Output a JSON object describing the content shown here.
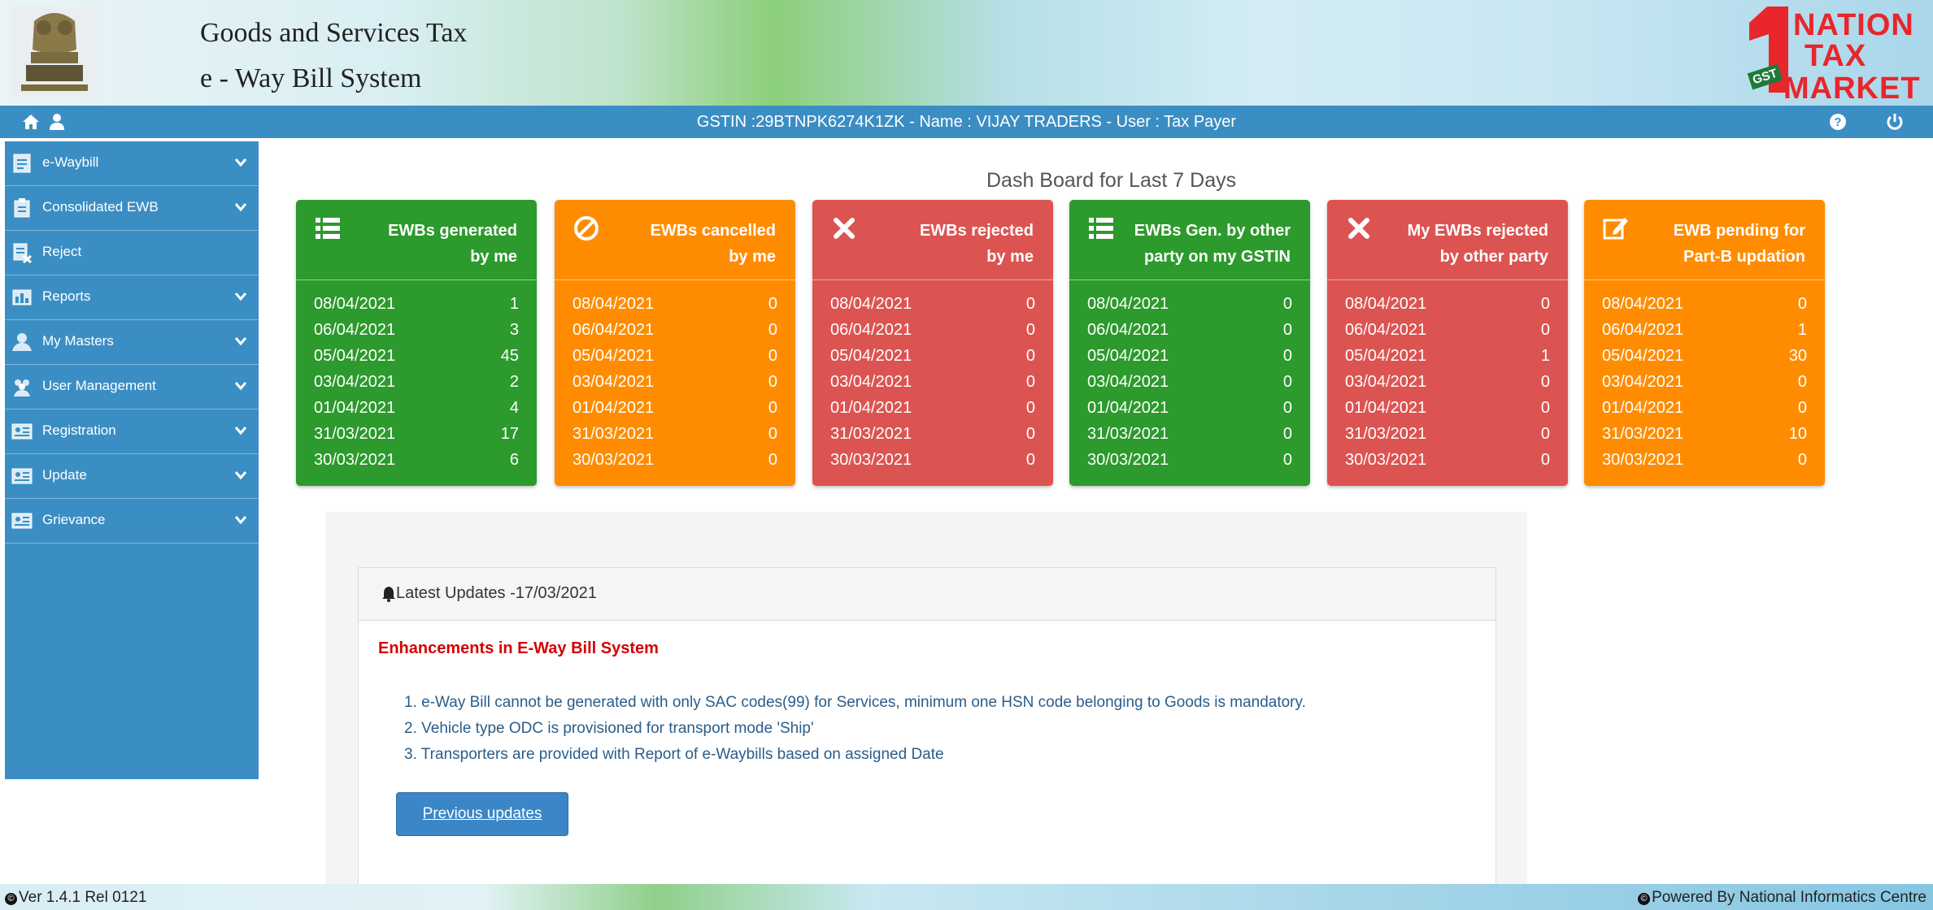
{
  "header": {
    "title": "Goods and Services Tax",
    "subtitle": "e - Way Bill System",
    "logo": {
      "line1": "NATION",
      "line2": "TAX",
      "line3": "MARKET",
      "badge": "GST"
    }
  },
  "topbar": {
    "gstin_text": "GSTIN :29BTNPK6274K1ZK - Name : VIJAY TRADERS - User : Tax Payer",
    "icons": [
      "home-icon",
      "user-icon",
      "help-icon",
      "power-icon"
    ]
  },
  "sidebar": {
    "items": [
      {
        "label": "e-Waybill",
        "icon": "document-icon",
        "has_submenu": true
      },
      {
        "label": "Consolidated EWB",
        "icon": "clipboard-icon",
        "has_submenu": true
      },
      {
        "label": "Reject",
        "icon": "reject-document-icon",
        "has_submenu": false
      },
      {
        "label": "Reports",
        "icon": "report-icon",
        "has_submenu": true
      },
      {
        "label": "My Masters",
        "icon": "user-master-icon",
        "has_submenu": true
      },
      {
        "label": "User Management",
        "icon": "users-icon",
        "has_submenu": true
      },
      {
        "label": "Registration",
        "icon": "id-card-icon",
        "has_submenu": true
      },
      {
        "label": "Update",
        "icon": "id-card-icon",
        "has_submenu": true
      },
      {
        "label": "Grievance",
        "icon": "id-card-icon",
        "has_submenu": true
      }
    ]
  },
  "dashboard": {
    "title": "Dash Board for Last 7 Days",
    "cards": [
      {
        "title_line1": "EWBs generated",
        "title_line2": "by me",
        "color": "#2c9a2c",
        "icon": "list-icon",
        "rows": [
          [
            "08/04/2021",
            "1"
          ],
          [
            "06/04/2021",
            "3"
          ],
          [
            "05/04/2021",
            "45"
          ],
          [
            "03/04/2021",
            "2"
          ],
          [
            "01/04/2021",
            "4"
          ],
          [
            "31/03/2021",
            "17"
          ],
          [
            "30/03/2021",
            "6"
          ]
        ]
      },
      {
        "title_line1": "EWBs cancelled",
        "title_line2": "by me",
        "color": "#ff8c00",
        "icon": "ban-icon",
        "rows": [
          [
            "08/04/2021",
            "0"
          ],
          [
            "06/04/2021",
            "0"
          ],
          [
            "05/04/2021",
            "0"
          ],
          [
            "03/04/2021",
            "0"
          ],
          [
            "01/04/2021",
            "0"
          ],
          [
            "31/03/2021",
            "0"
          ],
          [
            "30/03/2021",
            "0"
          ]
        ]
      },
      {
        "title_line1": "EWBs rejected",
        "title_line2": "by me",
        "color": "#dc5451",
        "icon": "close-icon",
        "rows": [
          [
            "08/04/2021",
            "0"
          ],
          [
            "06/04/2021",
            "0"
          ],
          [
            "05/04/2021",
            "0"
          ],
          [
            "03/04/2021",
            "0"
          ],
          [
            "01/04/2021",
            "0"
          ],
          [
            "31/03/2021",
            "0"
          ],
          [
            "30/03/2021",
            "0"
          ]
        ]
      },
      {
        "title_line1": "EWBs Gen. by other",
        "title_line2": "party on my GSTIN",
        "color": "#2c9a2c",
        "icon": "list-icon",
        "rows": [
          [
            "08/04/2021",
            "0"
          ],
          [
            "06/04/2021",
            "0"
          ],
          [
            "05/04/2021",
            "0"
          ],
          [
            "03/04/2021",
            "0"
          ],
          [
            "01/04/2021",
            "0"
          ],
          [
            "31/03/2021",
            "0"
          ],
          [
            "30/03/2021",
            "0"
          ]
        ]
      },
      {
        "title_line1": "My EWBs rejected",
        "title_line2": "by other party",
        "color": "#dc5451",
        "icon": "close-icon",
        "rows": [
          [
            "08/04/2021",
            "0"
          ],
          [
            "06/04/2021",
            "0"
          ],
          [
            "05/04/2021",
            "1"
          ],
          [
            "03/04/2021",
            "0"
          ],
          [
            "01/04/2021",
            "0"
          ],
          [
            "31/03/2021",
            "0"
          ],
          [
            "30/03/2021",
            "0"
          ]
        ]
      },
      {
        "title_line1": "EWB pending for",
        "title_line2": "Part-B updation",
        "color": "#ff8c00",
        "icon": "edit-icon",
        "rows": [
          [
            "08/04/2021",
            "0"
          ],
          [
            "06/04/2021",
            "1"
          ],
          [
            "05/04/2021",
            "30"
          ],
          [
            "03/04/2021",
            "0"
          ],
          [
            "01/04/2021",
            "0"
          ],
          [
            "31/03/2021",
            "10"
          ],
          [
            "30/03/2021",
            "0"
          ]
        ]
      }
    ]
  },
  "updates": {
    "heading": "Latest Updates -17/03/2021",
    "subheading": "Enhancements in E-Way Bill System",
    "items": [
      "1. e-Way Bill cannot be generated with only SAC codes(99) for Services, minimum one HSN code belonging to Goods is mandatory.",
      "2. Vehicle type ODC is provisioned for transport mode 'Ship'",
      "3. Transporters are provided with Report of e-Waybills based on assigned Date"
    ],
    "button_label": "Previous updates"
  },
  "footer": {
    "version": "Ver 1.4.1 Rel 0121",
    "powered_by": "Powered By National Informatics Centre"
  }
}
